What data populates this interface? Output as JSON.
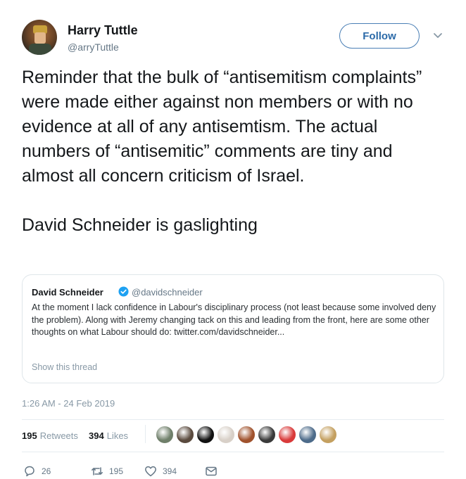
{
  "author": {
    "display_name": "Harry Tuttle",
    "handle": "@arryTuttle"
  },
  "follow_label": "Follow",
  "tweet_text": "Reminder that the bulk of “antisemitism complaints” were made either against non members or with no evidence at all of any antisemtism. The actual numbers of “antisemitic” comments are tiny and almost all concern criticism of Israel.\n\nDavid Schneider is gaslighting",
  "quoted": {
    "display_name": "David Schneider",
    "handle": "@davidschneider",
    "text": "At the moment I lack confidence in Labour's disciplinary process (not least because some involved deny the problem). Along with Jeremy changing tack on this and leading from the front, here are some other thoughts on what Labour should do: twitter.com/davidschneider...",
    "show_thread": "Show this thread"
  },
  "timestamp": "1:26 AM - 24 Feb 2019",
  "stats": {
    "retweets_count": "195",
    "retweets_label": "Retweets",
    "likes_count": "394",
    "likes_label": "Likes"
  },
  "likers": [
    {
      "color": "#6f7f6a"
    },
    {
      "color": "#5a4a3e"
    },
    {
      "color": "#111111"
    },
    {
      "color": "#d8d0c8"
    },
    {
      "color": "#a0522d"
    },
    {
      "color": "#3a3a3a"
    },
    {
      "color": "#d93a3a"
    },
    {
      "color": "#4d6b8a"
    },
    {
      "color": "#c4a060"
    }
  ],
  "actions": {
    "reply_count": "26",
    "retweet_count": "195",
    "like_count": "394"
  },
  "colors": {
    "accent": "#1da1f2",
    "verified": "#1da1f2",
    "muted": "#657786"
  },
  "icons": [
    "chevron-down-icon",
    "verified-icon",
    "reply-icon",
    "retweet-icon",
    "like-icon",
    "message-icon"
  ]
}
